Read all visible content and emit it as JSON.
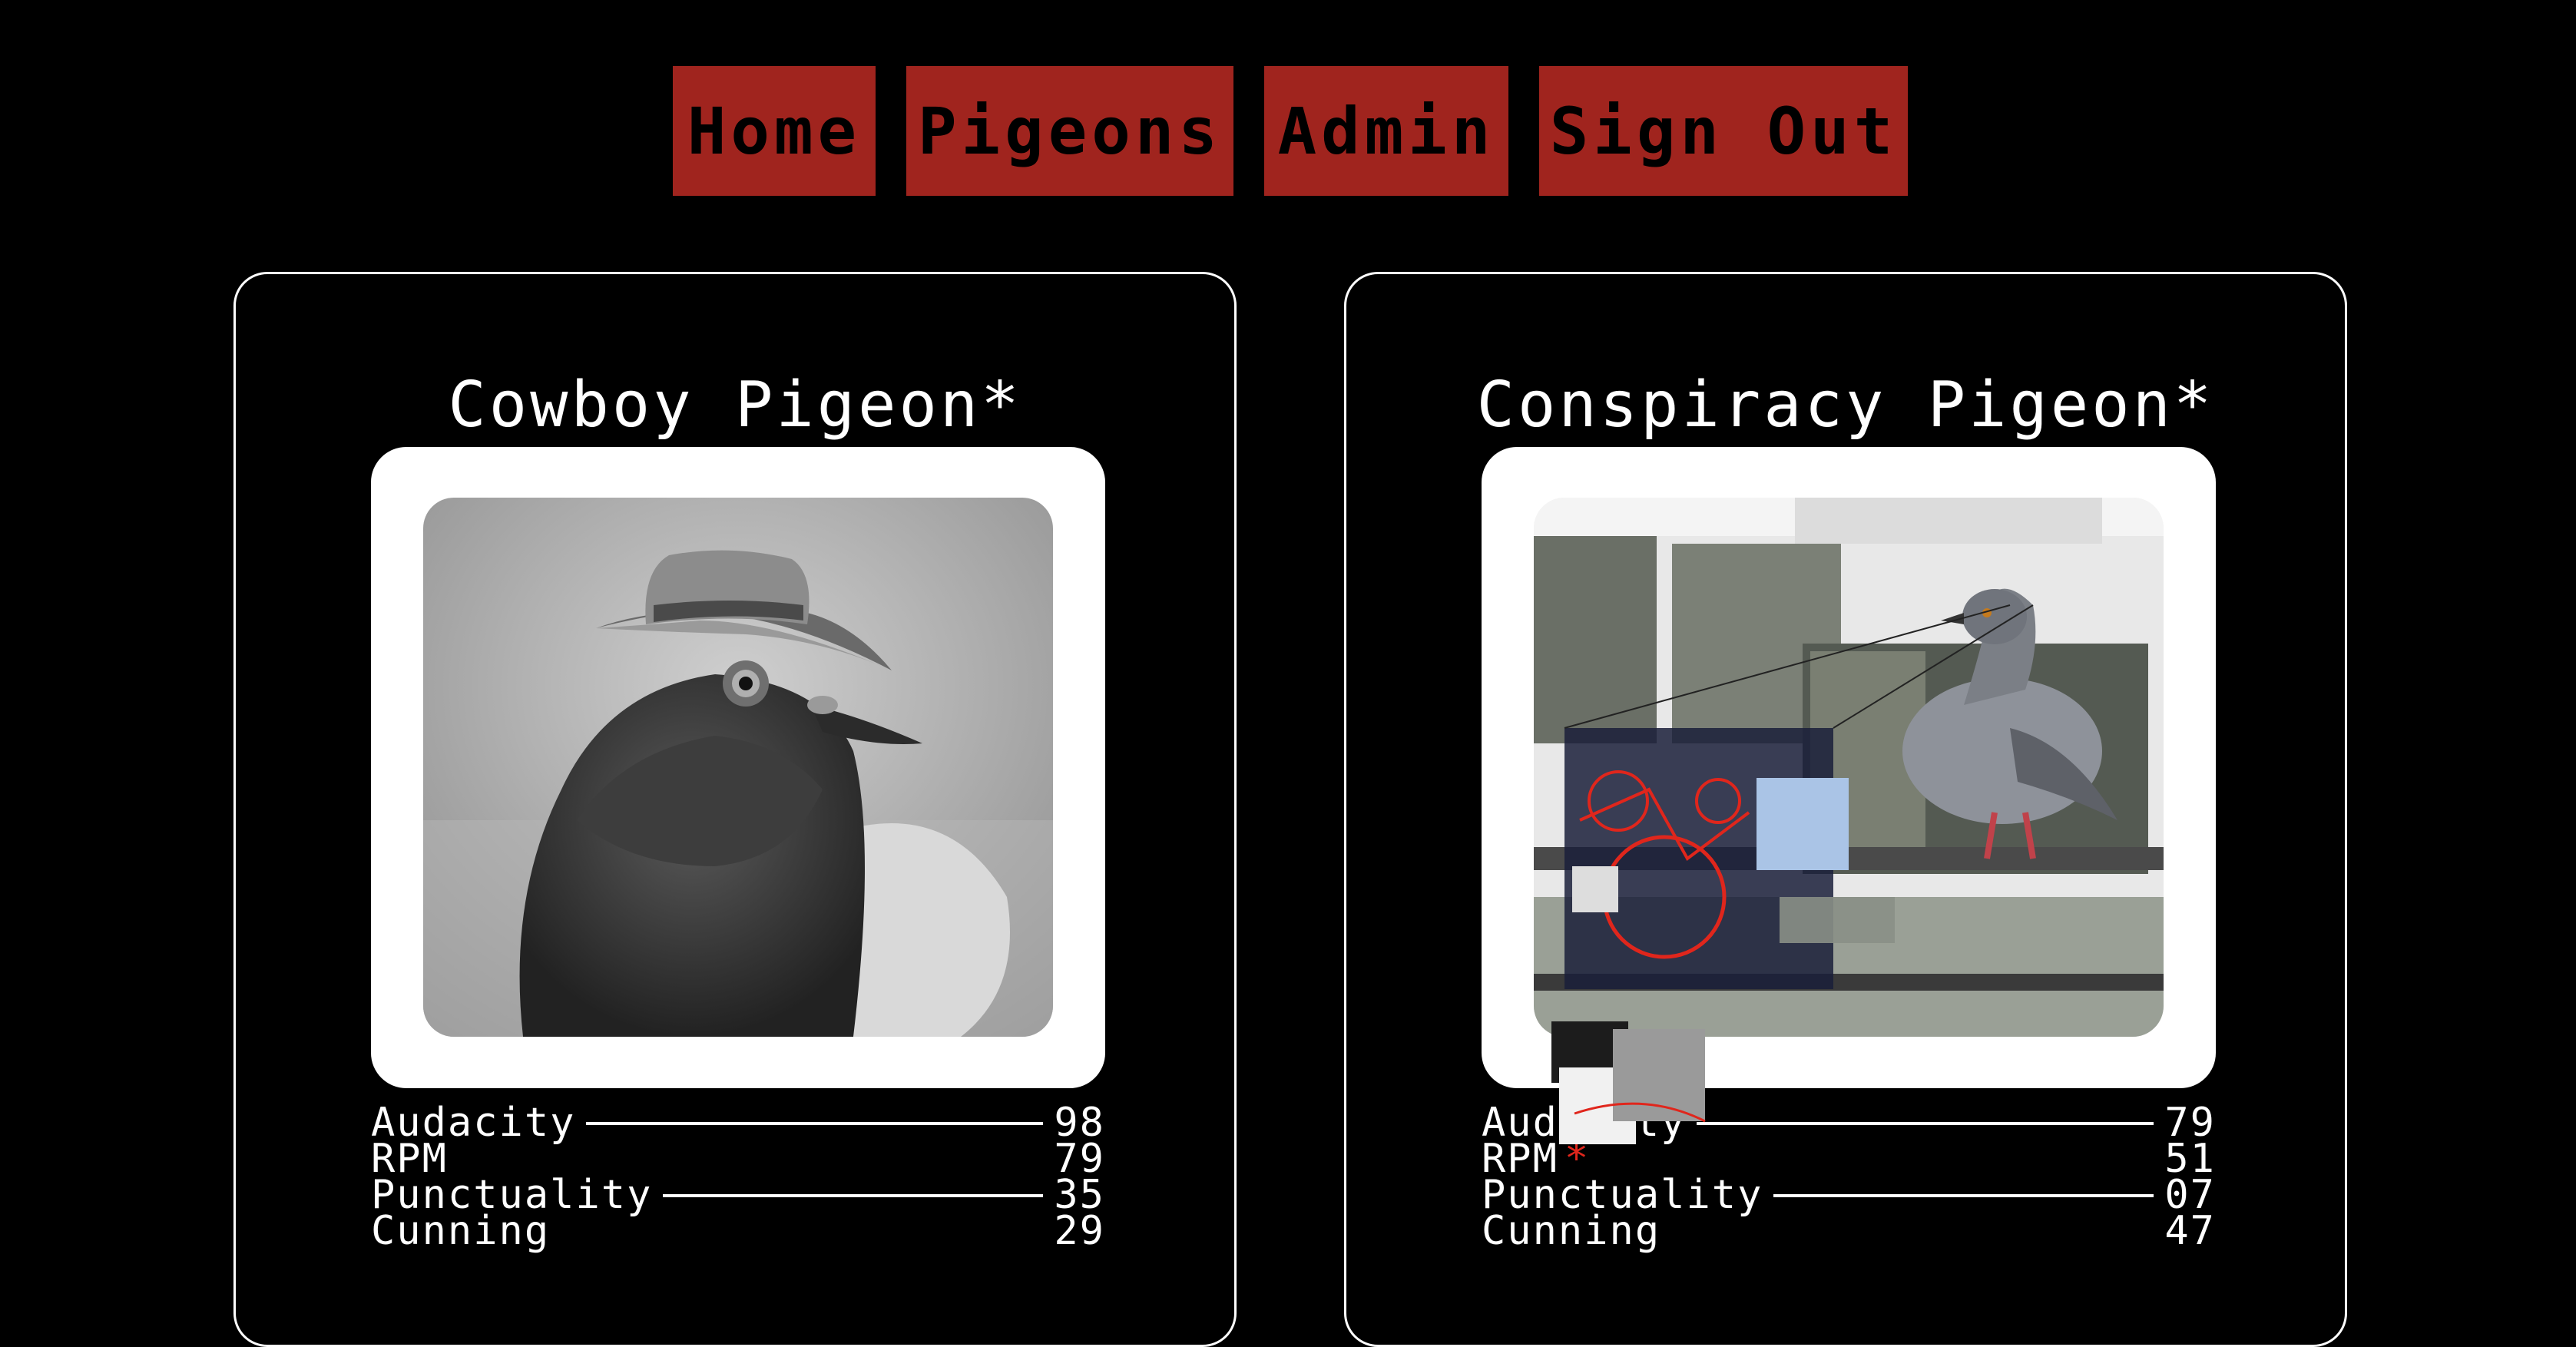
{
  "nav": {
    "items": [
      {
        "label": "Home"
      },
      {
        "label": "Pigeons"
      },
      {
        "label": "Admin"
      },
      {
        "label": "Sign Out"
      }
    ]
  },
  "cards": [
    {
      "title": "Cowboy Pigeon*",
      "image_alt": "grayscale pigeon wearing a cowboy hat",
      "stats": [
        {
          "label": "Audacity",
          "value": "98"
        },
        {
          "label": "RPM",
          "value": "79"
        },
        {
          "label": "Punctuality",
          "value": "35"
        },
        {
          "label": "Cunning",
          "value": "29"
        }
      ]
    },
    {
      "title": "Conspiracy Pigeon*",
      "image_alt": "pigeon on a railing with conspiracy board overlay",
      "stats": [
        {
          "label": "Audacity",
          "value": "79"
        },
        {
          "label": "RPM",
          "value": "51",
          "marker": "*"
        },
        {
          "label": "Punctuality",
          "value": "07"
        },
        {
          "label": "Cunning",
          "value": "47"
        }
      ]
    }
  ],
  "colors": {
    "background": "#000000",
    "nav_button": "#a0241e",
    "nav_text": "#000000",
    "card_border": "#ffffff",
    "accent_red": "#e0261c"
  }
}
